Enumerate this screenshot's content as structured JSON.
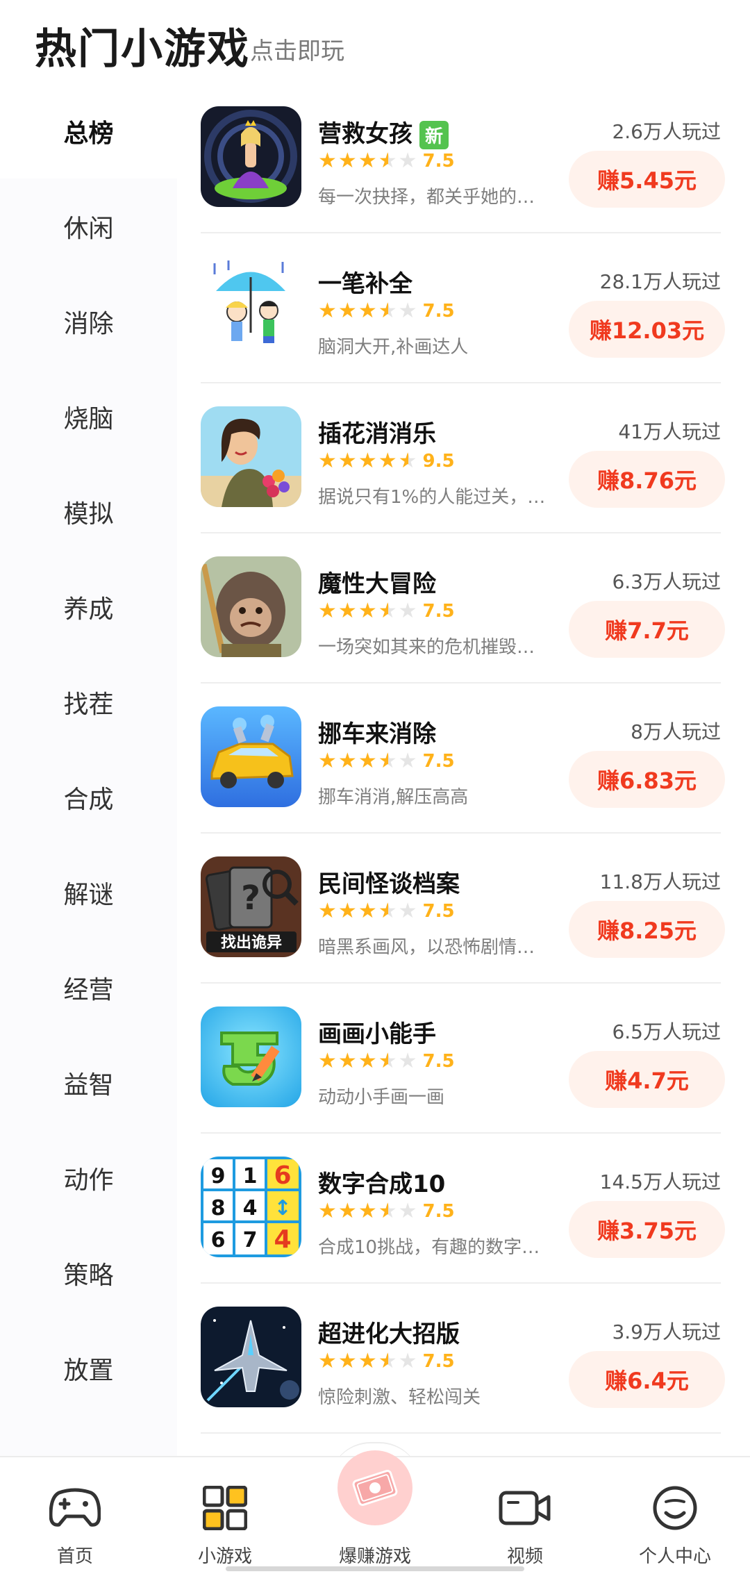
{
  "header": {
    "title": "热门小游戏",
    "subtitle": "点击即玩"
  },
  "sidebar": {
    "items": [
      {
        "label": "总榜",
        "active": true
      },
      {
        "label": "休闲"
      },
      {
        "label": "消除"
      },
      {
        "label": "烧脑"
      },
      {
        "label": "模拟"
      },
      {
        "label": "养成"
      },
      {
        "label": "找茬"
      },
      {
        "label": "合成"
      },
      {
        "label": "解谜"
      },
      {
        "label": "经营"
      },
      {
        "label": "益智"
      },
      {
        "label": "动作"
      },
      {
        "label": "策略"
      },
      {
        "label": "放置"
      }
    ]
  },
  "games": [
    {
      "name": "营救女孩",
      "badge": "新",
      "rating": "7.5",
      "rating_value": 3.5,
      "desc": "每一次抉择，都关乎她的命 …",
      "plays": "2.6万人玩过",
      "earn": "赚5.45元",
      "icon": "princess-icon"
    },
    {
      "name": "一笔补全",
      "rating": "7.5",
      "rating_value": 3.5,
      "desc": "脑洞大开,补画达人",
      "plays": "28.1万人玩过",
      "earn": "赚12.03元",
      "icon": "umbrella-kids-icon"
    },
    {
      "name": "插花消消乐",
      "rating": "9.5",
      "rating_value": 4.5,
      "desc": "据说只有1%的人能过关， 是 …",
      "plays": "41万人玩过",
      "earn": "赚8.76元",
      "icon": "flower-lady-icon"
    },
    {
      "name": "魔性大冒险",
      "rating": "7.5",
      "rating_value": 3.5,
      "desc": "一场突如其来的危机摧毁了 …",
      "plays": "6.3万人玩过",
      "earn": "赚7.7元",
      "icon": "monkey-icon"
    },
    {
      "name": "挪车来消除",
      "rating": "7.5",
      "rating_value": 3.5,
      "desc": "挪车消消,解压高高",
      "plays": "8万人玩过",
      "earn": "赚6.83元",
      "icon": "yellow-car-icon"
    },
    {
      "name": "民间怪谈档案",
      "rating": "7.5",
      "rating_value": 3.5,
      "desc": "暗黑系画风，以恐怖剧情为 …",
      "plays": "11.8万人玩过",
      "earn": "赚8.25元",
      "icon": "mystery-cards-icon",
      "icon_caption": "找出诡异"
    },
    {
      "name": "画画小能手",
      "rating": "7.5",
      "rating_value": 3.5,
      "desc": "动动小手画一画",
      "plays": "6.5万人玩过",
      "earn": "赚4.7元",
      "icon": "draw-pencil-icon"
    },
    {
      "name": "数字合成10",
      "rating": "7.5",
      "rating_value": 3.5,
      "desc": "合成10挑战，有趣的数字类 …",
      "plays": "14.5万人玩过",
      "earn": "赚3.75元",
      "icon": "number-grid-icon",
      "icon_digits": [
        "9",
        "1",
        "6",
        "8",
        "4",
        "↕",
        "6",
        "7",
        "4"
      ]
    },
    {
      "name": "超进化大招版",
      "rating": "7.5",
      "rating_value": 3.5,
      "desc": "惊险刺激、轻松闯关",
      "plays": "3.9万人玩过",
      "earn": "赚6.4元",
      "icon": "spaceship-icon"
    }
  ],
  "tabbar": {
    "items": [
      {
        "label": "首页",
        "icon": "gamepad-icon"
      },
      {
        "label": "小游戏",
        "icon": "grid-icon"
      },
      {
        "label": "爆赚游戏",
        "icon": "money-icon"
      },
      {
        "label": "视频",
        "icon": "video-camera-icon"
      },
      {
        "label": "个人中心",
        "icon": "smiley-face-icon"
      }
    ]
  },
  "colors": {
    "accent": "#f03a1f",
    "star": "#ffb21a",
    "badge": "#54c34f",
    "earn_bg": "#fff2ec"
  }
}
